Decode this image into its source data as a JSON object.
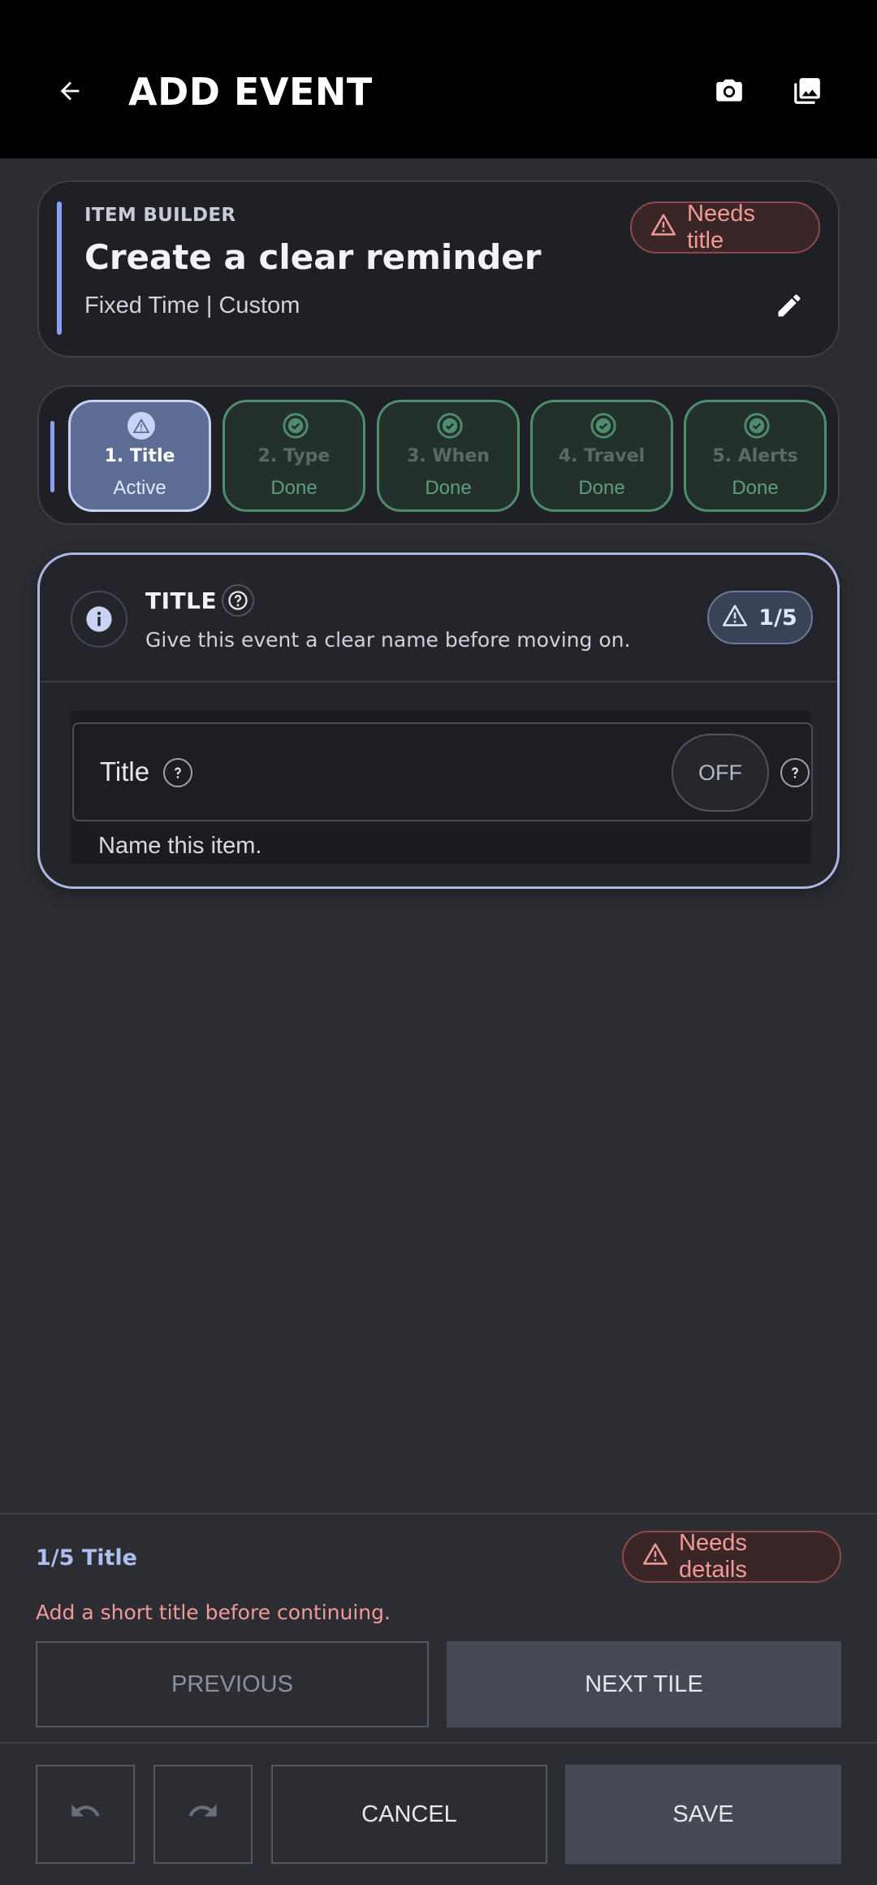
{
  "appbar": {
    "title": "ADD EVENT",
    "back_icon": "arrow-left-icon",
    "camera_icon": "camera-icon",
    "gallery_icon": "image-gallery-icon"
  },
  "builder": {
    "overline": "ITEM BUILDER",
    "headline": "Create a clear reminder",
    "subtitle": "Fixed Time | Custom",
    "status_chip": "Needs title",
    "edit_icon": "pencil-icon"
  },
  "steps": [
    {
      "label": "1. Title",
      "status": "Active",
      "icon": "warning-icon",
      "active": true
    },
    {
      "label": "2. Type",
      "status": "Done",
      "icon": "check-circle-icon",
      "active": false
    },
    {
      "label": "3. When",
      "status": "Done",
      "icon": "check-circle-icon",
      "active": false
    },
    {
      "label": "4. Travel",
      "status": "Done",
      "icon": "check-circle-icon",
      "active": false
    },
    {
      "label": "5. Alerts",
      "status": "Done",
      "icon": "check-circle-icon",
      "active": false
    }
  ],
  "panel": {
    "title": "TITLE",
    "description": "Give this event a clear name before moving on.",
    "count": "1/5",
    "field_label": "Title",
    "toggle": "OFF",
    "hint": "Name this item."
  },
  "footer": {
    "progress": "1/5 Title",
    "status_chip": "Needs details",
    "error": "Add a short title before continuing.",
    "previous": "PREVIOUS",
    "next": "NEXT TILE",
    "cancel": "CANCEL",
    "save": "SAVE"
  },
  "colors": {
    "accent": "#8d9ff0",
    "warning": "#f29a98",
    "done": "#5f9d7c"
  }
}
